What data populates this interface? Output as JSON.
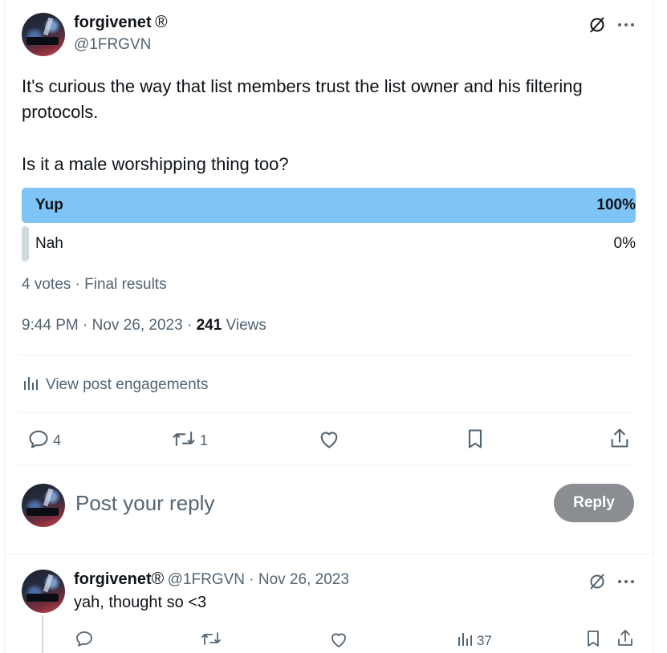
{
  "post": {
    "display_name": "forgivenet",
    "verified_mark": "®",
    "handle": "@1FRGVN",
    "text_line1": "It's curious the way that list members trust the list owner and his filtering",
    "text_line2": "protocols.",
    "text_line3": "Is it a male worshipping thing too?",
    "poll": {
      "options": [
        {
          "label": "Yup",
          "percent_text": "100%",
          "fraction": 1.0,
          "winner": true
        },
        {
          "label": "Nah",
          "percent_text": "0%",
          "fraction": 0.0,
          "winner": false
        }
      ],
      "summary": "4 votes · Final results"
    },
    "timestamp": "9:44 PM · Nov 26, 2023 · ",
    "views_count": "241",
    "views_label": " Views",
    "engagements_label": "View post engagements",
    "reply_count": "4",
    "repost_count": "1"
  },
  "composer": {
    "placeholder": "Post your reply",
    "reply_label": "Reply"
  },
  "reply": {
    "display_name": "forgivenet",
    "verified_mark": "®",
    "handle_date": "@1FRGVN · Nov 26, 2023",
    "text": "yah, thought so <3",
    "views_count": "37"
  },
  "colors": {
    "poll_winner": "#7fc4f6",
    "poll_loser": "#cfd9de",
    "muted": "#536471",
    "reply_button": "#8a8d91"
  }
}
